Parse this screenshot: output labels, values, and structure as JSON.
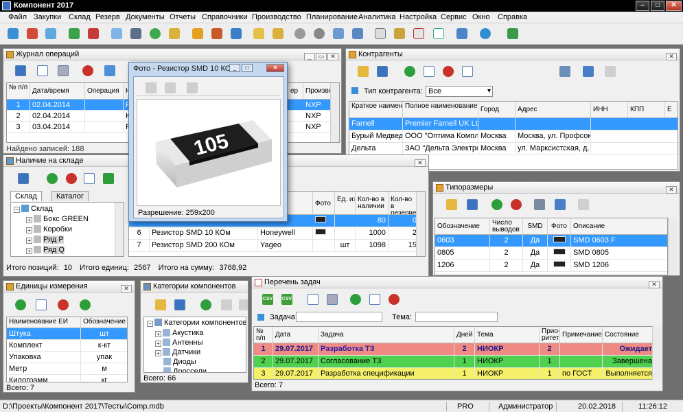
{
  "app": {
    "title": "Компонент 2017"
  },
  "menu": [
    "Файл",
    "Закупки",
    "Склад",
    "Резерв",
    "Документы",
    "Отчеты",
    "Справочники",
    "Производство",
    "Планирование",
    "Аналитика",
    "Настройка",
    "Сервис",
    "Окно",
    "Справка"
  ],
  "journal": {
    "title": "Журнал операций",
    "headers": {
      "num": "№ п/п",
      "date": "Дата/время",
      "op": "Операция",
      "h4": "На",
      "h5": "ер",
      "h6": "Произво"
    },
    "rows": [
      {
        "num": "1",
        "date": "02.04.2014",
        "h4": "Резис",
        "h6": "NXP"
      },
      {
        "num": "2",
        "date": "02.04.2014",
        "h4": "Конд",
        "h6": "NXP"
      },
      {
        "num": "3",
        "date": "03.04.2014",
        "h4": "Резис",
        "h6": "NXP"
      }
    ],
    "footer": "Найдено записей: 188"
  },
  "contractors": {
    "title": "Контрагенты",
    "filter_label": "Тип контрагента:",
    "filter_value": "Все",
    "headers": {
      "short": "Краткое наименование",
      "full": "Полное наименование",
      "city": "Город",
      "addr": "Адрес",
      "inn": "ИНН",
      "kpp": "КПП",
      "e": "Е"
    },
    "rows": [
      {
        "short": "Farnell",
        "full": "Premier Farnell UK Ltd.",
        "city": "",
        "addr": ""
      },
      {
        "short": "Бурый Медведь",
        "full": "ООО \"Оптима Комплект",
        "city": "Москва",
        "addr": "Москва, ул. Профсоюзн..."
      },
      {
        "short": "Дельта",
        "full": "ЗАО \"Дельта Электрон...",
        "city": "Москва",
        "addr": "ул. Марксистская, д. 34..."
      }
    ]
  },
  "photo_window": {
    "title": "Фото - Резистор SMD 10 КОм",
    "resistor_code": "105",
    "resolution": "Разрешение:  259x200"
  },
  "stock": {
    "title": "Наличие на складе",
    "tab_stock": "Склад",
    "tab_catalog": "Каталог",
    "tree": {
      "root": "Склад",
      "items": [
        "Бокс GREEN",
        "Коробки",
        "Ряд Р",
        "Ряд Q"
      ]
    },
    "headers": {
      "mfr": "итель",
      "photo": "Фото",
      "unit": "Ед. изм.",
      "qty": "Кол-во в наличии",
      "res": "Кол-во в резерве"
    },
    "rows": [
      {
        "num": "",
        "name": "",
        "mfr": "",
        "unit": "",
        "qty": "80",
        "res": "0"
      },
      {
        "num": "6",
        "name": "Резистор SMD 10 КОм",
        "mfr": "Honeywell",
        "unit": "",
        "qty": "1000",
        "res": "2"
      },
      {
        "num": "7",
        "name": "Резистор SMD 200 КОм",
        "mfr": "Yageo",
        "unit": "шт",
        "qty": "1098",
        "res": "15"
      }
    ],
    "footer": {
      "positions_label": "Итого позиций:",
      "positions": "10",
      "units_label": "Итого единиц:",
      "units": "2567",
      "sum_label": "Итого на сумму:",
      "sum": "3768,92"
    }
  },
  "sizes": {
    "title": "Типоразмеры",
    "headers": {
      "name": "Обозначение",
      "pins": "Число выводов",
      "smd": "SMD",
      "photo": "Фото",
      "desc": "Описание"
    },
    "rows": [
      {
        "name": "0603",
        "pins": "2",
        "smd": "Да",
        "desc": "SMD 0603 F"
      },
      {
        "name": "0805",
        "pins": "2",
        "smd": "Да",
        "desc": "SMD 0805"
      },
      {
        "name": "1206",
        "pins": "2",
        "smd": "Да",
        "desc": "SMD 1206"
      }
    ]
  },
  "units": {
    "title": "Единицы измерения",
    "headers": {
      "name": "Наименование ЕИ",
      "code": "Обозначение"
    },
    "rows": [
      {
        "name": "Штука",
        "code": "шт"
      },
      {
        "name": "Комплект",
        "code": "к-кт"
      },
      {
        "name": "Упаковка",
        "code": "упак"
      },
      {
        "name": "Метр",
        "code": "м"
      },
      {
        "name": "Килограмм",
        "code": "кг"
      }
    ],
    "footer": "Всего: 7"
  },
  "categories": {
    "title": "Категории компонентов",
    "tree": {
      "root": "Категории компонентов",
      "items": [
        "Акустика",
        "Антенны",
        "Датчики",
        "Диоды",
        "Дроссели"
      ]
    },
    "footer": "Всего: 66"
  },
  "tasks": {
    "title": "Перечень задач",
    "csv": "CSV",
    "filter_task_label": "Задача:",
    "filter_theme_label": "Тема:",
    "headers": {
      "num": "№ п/п",
      "date": "Дата",
      "task": "Задача",
      "days": "Дней",
      "theme": "Тема",
      "prio": "Прио-ритет",
      "note": "Примечание",
      "state": "Состояние"
    },
    "rows": [
      {
        "num": "1",
        "date": "29.07.2017",
        "task": "Разработка ТЗ",
        "days": "2",
        "theme": "НИОКР",
        "prio": "2",
        "note": "",
        "state": "Ожидает",
        "color": "#f08a84"
      },
      {
        "num": "2",
        "date": "29.07.2017",
        "task": "Согласование ТЗ",
        "days": "1",
        "theme": "НИОКР",
        "prio": "1",
        "note": "",
        "state": "Завершена",
        "color": "#4fd04f"
      },
      {
        "num": "3",
        "date": "29.07.2017",
        "task": "Разработка спецификации",
        "days": "1",
        "theme": "НИОКР",
        "prio": "1",
        "note": "по ГОСТ",
        "state": "Выполняется",
        "color": "#f5f06a"
      }
    ],
    "footer": "Всего: 7"
  },
  "statusbar": {
    "path": "D:\\Проекты\\Компонент 2017\\Тесты\\Comp.mdb",
    "edition": "PRO",
    "user": "Администратор",
    "date": "20.02.2018",
    "time": "11:26:12"
  }
}
